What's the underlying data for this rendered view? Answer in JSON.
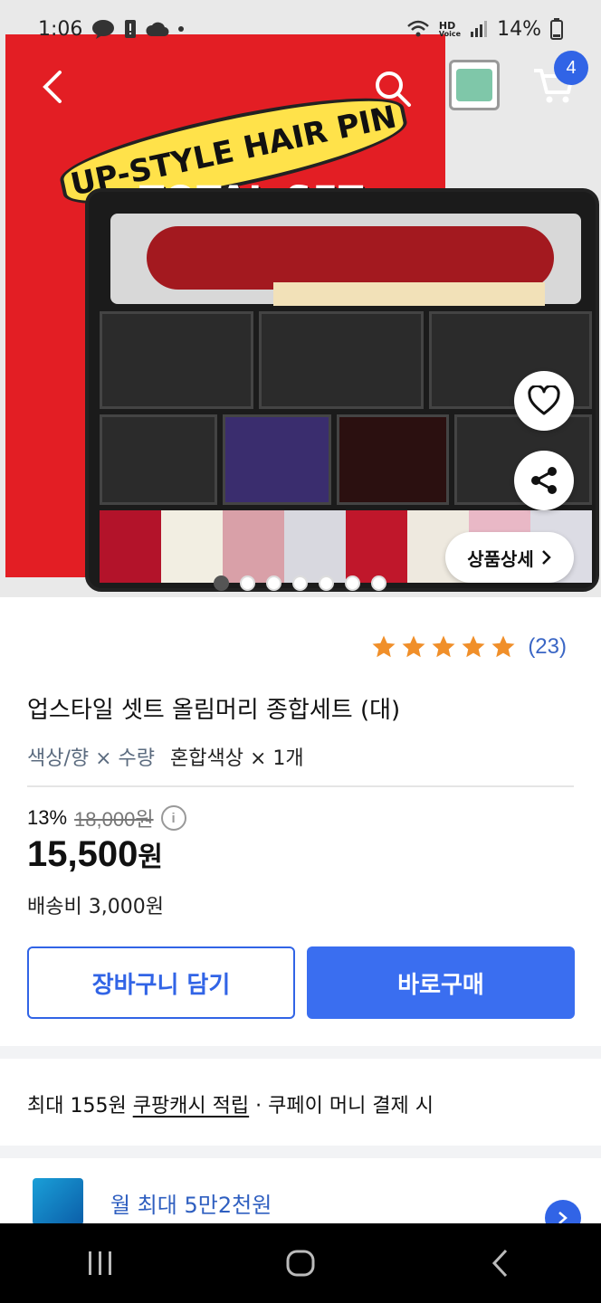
{
  "status": {
    "time": "1:06",
    "network": "HD",
    "network_sub": "Voice",
    "battery": "14%"
  },
  "header": {
    "cart_count": "4"
  },
  "hero": {
    "box_title": "UP-STYLE HAIR PIN",
    "box_subtitle": "TOTAL SET",
    "detail_button": "상품상세",
    "slides_total": 7,
    "slides_active": 1
  },
  "product": {
    "rating_stars": 5,
    "review_count": "(23)",
    "name": "업스타일 셋트 올림머리 종합세트 (대)",
    "option_key": "색상/향 × 수량",
    "option_value": "혼합색상 × 1개",
    "discount": "13%",
    "original_price": "18,000원",
    "price": "15,500",
    "price_unit": "원",
    "shipping": "배송비 3,000원"
  },
  "actions": {
    "add_cart": "장바구니 담기",
    "buy_now": "바로구매"
  },
  "cash": {
    "prefix": "최대 155원 ",
    "link": "쿠팡캐시 적립",
    "suffix": " · 쿠페이 머니 결제 시"
  },
  "promo": {
    "text": "월 최대 5만2천원"
  },
  "colors": {
    "accent": "#3164e6",
    "star": "#f08f2a",
    "box_red": "#e31e24"
  }
}
